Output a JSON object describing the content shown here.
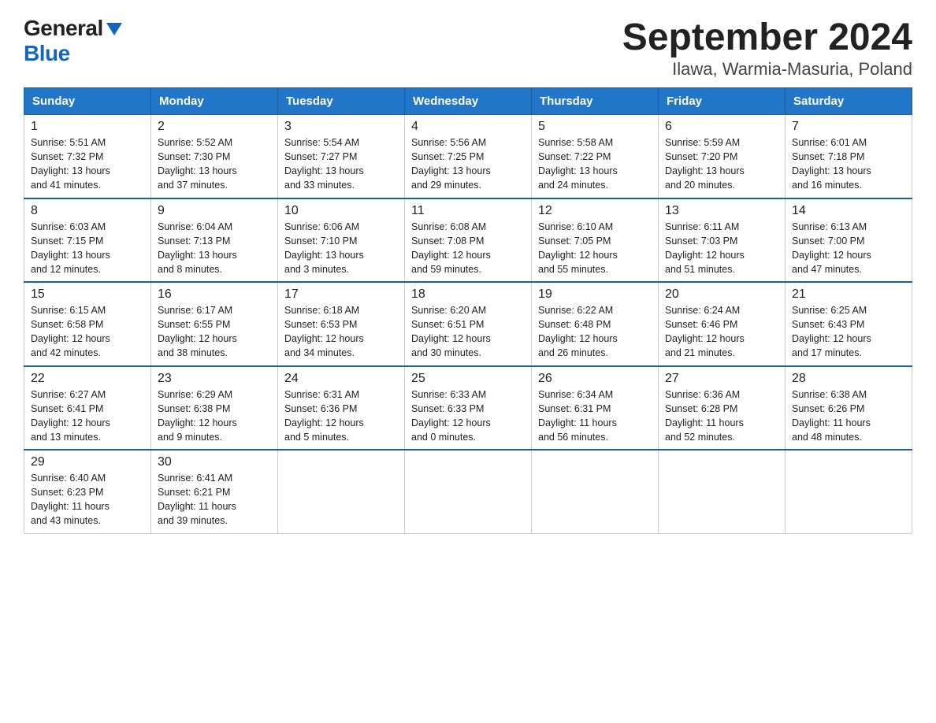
{
  "header": {
    "logo_general": "General",
    "logo_blue": "Blue",
    "title": "September 2024",
    "subtitle": "Ilawa, Warmia-Masuria, Poland"
  },
  "days_of_week": [
    "Sunday",
    "Monday",
    "Tuesday",
    "Wednesday",
    "Thursday",
    "Friday",
    "Saturday"
  ],
  "weeks": [
    [
      {
        "day": "1",
        "sunrise": "5:51 AM",
        "sunset": "7:32 PM",
        "daylight": "13 hours and 41 minutes."
      },
      {
        "day": "2",
        "sunrise": "5:52 AM",
        "sunset": "7:30 PM",
        "daylight": "13 hours and 37 minutes."
      },
      {
        "day": "3",
        "sunrise": "5:54 AM",
        "sunset": "7:27 PM",
        "daylight": "13 hours and 33 minutes."
      },
      {
        "day": "4",
        "sunrise": "5:56 AM",
        "sunset": "7:25 PM",
        "daylight": "13 hours and 29 minutes."
      },
      {
        "day": "5",
        "sunrise": "5:58 AM",
        "sunset": "7:22 PM",
        "daylight": "13 hours and 24 minutes."
      },
      {
        "day": "6",
        "sunrise": "5:59 AM",
        "sunset": "7:20 PM",
        "daylight": "13 hours and 20 minutes."
      },
      {
        "day": "7",
        "sunrise": "6:01 AM",
        "sunset": "7:18 PM",
        "daylight": "13 hours and 16 minutes."
      }
    ],
    [
      {
        "day": "8",
        "sunrise": "6:03 AM",
        "sunset": "7:15 PM",
        "daylight": "13 hours and 12 minutes."
      },
      {
        "day": "9",
        "sunrise": "6:04 AM",
        "sunset": "7:13 PM",
        "daylight": "13 hours and 8 minutes."
      },
      {
        "day": "10",
        "sunrise": "6:06 AM",
        "sunset": "7:10 PM",
        "daylight": "13 hours and 3 minutes."
      },
      {
        "day": "11",
        "sunrise": "6:08 AM",
        "sunset": "7:08 PM",
        "daylight": "12 hours and 59 minutes."
      },
      {
        "day": "12",
        "sunrise": "6:10 AM",
        "sunset": "7:05 PM",
        "daylight": "12 hours and 55 minutes."
      },
      {
        "day": "13",
        "sunrise": "6:11 AM",
        "sunset": "7:03 PM",
        "daylight": "12 hours and 51 minutes."
      },
      {
        "day": "14",
        "sunrise": "6:13 AM",
        "sunset": "7:00 PM",
        "daylight": "12 hours and 47 minutes."
      }
    ],
    [
      {
        "day": "15",
        "sunrise": "6:15 AM",
        "sunset": "6:58 PM",
        "daylight": "12 hours and 42 minutes."
      },
      {
        "day": "16",
        "sunrise": "6:17 AM",
        "sunset": "6:55 PM",
        "daylight": "12 hours and 38 minutes."
      },
      {
        "day": "17",
        "sunrise": "6:18 AM",
        "sunset": "6:53 PM",
        "daylight": "12 hours and 34 minutes."
      },
      {
        "day": "18",
        "sunrise": "6:20 AM",
        "sunset": "6:51 PM",
        "daylight": "12 hours and 30 minutes."
      },
      {
        "day": "19",
        "sunrise": "6:22 AM",
        "sunset": "6:48 PM",
        "daylight": "12 hours and 26 minutes."
      },
      {
        "day": "20",
        "sunrise": "6:24 AM",
        "sunset": "6:46 PM",
        "daylight": "12 hours and 21 minutes."
      },
      {
        "day": "21",
        "sunrise": "6:25 AM",
        "sunset": "6:43 PM",
        "daylight": "12 hours and 17 minutes."
      }
    ],
    [
      {
        "day": "22",
        "sunrise": "6:27 AM",
        "sunset": "6:41 PM",
        "daylight": "12 hours and 13 minutes."
      },
      {
        "day": "23",
        "sunrise": "6:29 AM",
        "sunset": "6:38 PM",
        "daylight": "12 hours and 9 minutes."
      },
      {
        "day": "24",
        "sunrise": "6:31 AM",
        "sunset": "6:36 PM",
        "daylight": "12 hours and 5 minutes."
      },
      {
        "day": "25",
        "sunrise": "6:33 AM",
        "sunset": "6:33 PM",
        "daylight": "12 hours and 0 minutes."
      },
      {
        "day": "26",
        "sunrise": "6:34 AM",
        "sunset": "6:31 PM",
        "daylight": "11 hours and 56 minutes."
      },
      {
        "day": "27",
        "sunrise": "6:36 AM",
        "sunset": "6:28 PM",
        "daylight": "11 hours and 52 minutes."
      },
      {
        "day": "28",
        "sunrise": "6:38 AM",
        "sunset": "6:26 PM",
        "daylight": "11 hours and 48 minutes."
      }
    ],
    [
      {
        "day": "29",
        "sunrise": "6:40 AM",
        "sunset": "6:23 PM",
        "daylight": "11 hours and 43 minutes."
      },
      {
        "day": "30",
        "sunrise": "6:41 AM",
        "sunset": "6:21 PM",
        "daylight": "11 hours and 39 minutes."
      },
      null,
      null,
      null,
      null,
      null
    ]
  ],
  "labels": {
    "sunrise": "Sunrise:",
    "sunset": "Sunset:",
    "daylight": "Daylight:"
  }
}
